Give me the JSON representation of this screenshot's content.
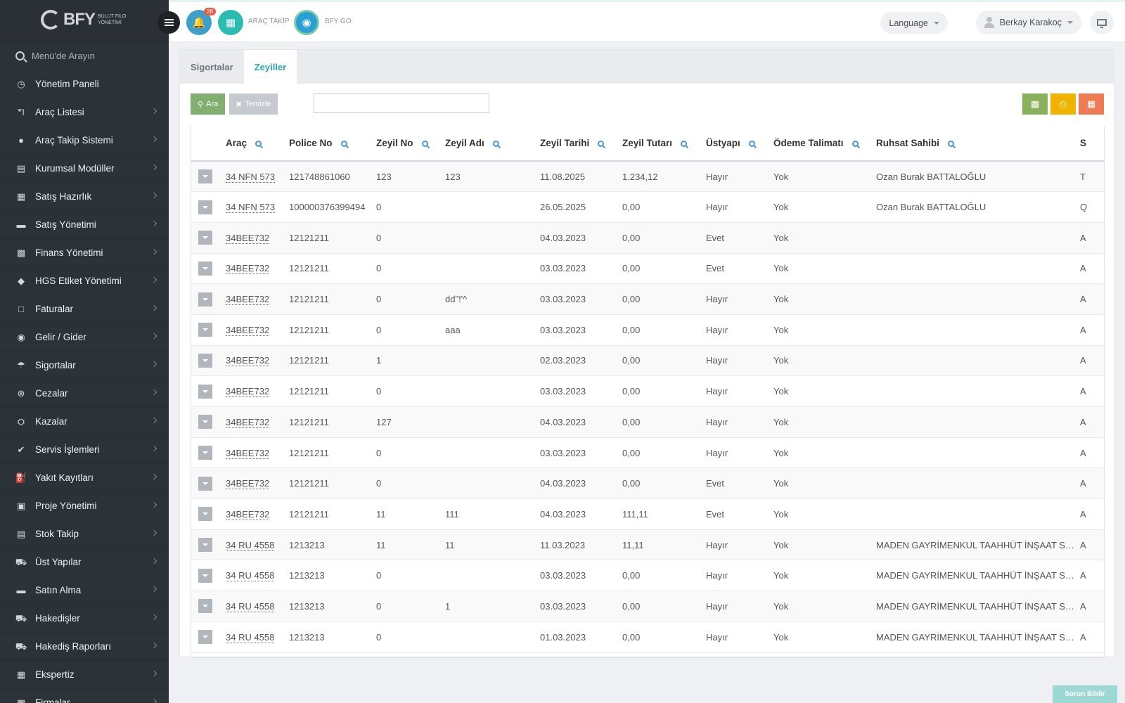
{
  "sidebar": {
    "logo": {
      "text": "BFY",
      "sub": "BULUT FİLO YÖNETİMİ"
    },
    "search_placeholder": "Menü'de Arayın",
    "items": [
      {
        "label": "Yönetim Paneli",
        "icon": "dashboard-icon",
        "chevron": false
      },
      {
        "label": "Araç Listesi",
        "icon": "car-icon",
        "chevron": true
      },
      {
        "label": "Araç Takip Sistemi",
        "icon": "map-marker-icon",
        "chevron": true
      },
      {
        "label": "Kurumsal Modüller",
        "icon": "server-icon",
        "chevron": true
      },
      {
        "label": "Satış Hazırlık",
        "icon": "book-icon",
        "chevron": true
      },
      {
        "label": "Satış Yönetimi",
        "icon": "card-icon",
        "chevron": true
      },
      {
        "label": "Finans Yönetimi",
        "icon": "money-icon",
        "chevron": true
      },
      {
        "label": "HGS Etiket Yönetimi",
        "icon": "tag-icon",
        "chevron": true
      },
      {
        "label": "Faturalar",
        "icon": "file-icon",
        "chevron": true
      },
      {
        "label": "Gelir / Gider",
        "icon": "income-icon",
        "chevron": true
      },
      {
        "label": "Sigortalar",
        "icon": "umbrella-icon",
        "chevron": true
      },
      {
        "label": "Cezalar",
        "icon": "cancel-icon",
        "chevron": true
      },
      {
        "label": "Kazalar",
        "icon": "accident-icon",
        "chevron": true
      },
      {
        "label": "Servis İşlemleri",
        "icon": "check-icon",
        "chevron": true
      },
      {
        "label": "Yakıt Kayıtları",
        "icon": "fuel-icon",
        "chevron": true
      },
      {
        "label": "Proje Yönetimi",
        "icon": "briefcase-icon",
        "chevron": true
      },
      {
        "label": "Stok Takip",
        "icon": "inbox-icon",
        "chevron": true
      },
      {
        "label": "Üst Yapılar",
        "icon": "truck-icon",
        "chevron": true
      },
      {
        "label": "Satın Alma",
        "icon": "credit-card-icon",
        "chevron": true
      },
      {
        "label": "Hakedişler",
        "icon": "truck-icon",
        "chevron": true
      },
      {
        "label": "Hakediş Raporları",
        "icon": "truck-icon",
        "chevron": true
      },
      {
        "label": "Ekspertiz",
        "icon": "building-icon",
        "chevron": true
      },
      {
        "label": "Firmalar",
        "icon": "building-icon",
        "chevron": true
      }
    ]
  },
  "topbar": {
    "notification_count": "28",
    "arac_takip": "ARAÇ TAKİP",
    "bfy_go": "BFY GO",
    "language": "Language",
    "user": "Berkay Karakoç",
    "colors": {
      "bell": "#3ea0c9",
      "map": "#2bbcb0",
      "go": "#2a9fd6"
    }
  },
  "tabs": [
    {
      "label": "Sigortalar",
      "active": false
    },
    {
      "label": "Zeyiller",
      "active": true
    }
  ],
  "toolbar": {
    "search_label": "Ara",
    "clear_label": "Temizle",
    "search_value": "",
    "export_colors": {
      "excel": "#8ab05c",
      "print": "#f0b400",
      "columns": "#ee7b54"
    }
  },
  "table": {
    "columns": [
      "Araç",
      "Police No",
      "Zeyil No",
      "Zeyil Adı",
      "Zeyil Tarihi",
      "Zeyil Tutarı",
      "Üstyapı",
      "Ödeme Talimatı",
      "Ruhsat Sahibi",
      "S"
    ],
    "rows": [
      [
        "34 NFN 573",
        "121748861060",
        "123",
        "123",
        "11.08.2025",
        "1.234,12",
        "Hayır",
        "Yok",
        "Ozan Burak BATTALOĞLU",
        "T"
      ],
      [
        "34 NFN 573",
        "100000376399494",
        "0",
        "",
        "26.05.2025",
        "0,00",
        "Hayır",
        "Yok",
        "Ozan Burak BATTALOĞLU",
        "Q"
      ],
      [
        "34BEE732",
        "12121211",
        "0",
        "",
        "04.03.2023",
        "0,00",
        "Evet",
        "Yok",
        "",
        "A"
      ],
      [
        "34BEE732",
        "12121211",
        "0",
        "",
        "03.03.2023",
        "0,00",
        "Evet",
        "Yok",
        "",
        "A"
      ],
      [
        "34BEE732",
        "12121211",
        "0",
        "dd\"!'^",
        "03.03.2023",
        "0,00",
        "Hayır",
        "Yok",
        "",
        "A"
      ],
      [
        "34BEE732",
        "12121211",
        "0",
        "aaa",
        "03.03.2023",
        "0,00",
        "Hayır",
        "Yok",
        "",
        "A"
      ],
      [
        "34BEE732",
        "12121211",
        "1",
        "",
        "02.03.2023",
        "0,00",
        "Hayır",
        "Yok",
        "",
        "A"
      ],
      [
        "34BEE732",
        "12121211",
        "0",
        "",
        "03.03.2023",
        "0,00",
        "Hayır",
        "Yok",
        "",
        "A"
      ],
      [
        "34BEE732",
        "12121211",
        "127",
        "",
        "04.03.2023",
        "0,00",
        "Hayır",
        "Yok",
        "",
        "A"
      ],
      [
        "34BEE732",
        "12121211",
        "0",
        "",
        "03.03.2023",
        "0,00",
        "Hayır",
        "Yok",
        "",
        "A"
      ],
      [
        "34BEE732",
        "12121211",
        "0",
        "",
        "04.03.2023",
        "0,00",
        "Evet",
        "Yok",
        "",
        "A"
      ],
      [
        "34BEE732",
        "12121211",
        "11",
        "111",
        "04.03.2023",
        "111,11",
        "Evet",
        "Yok",
        "",
        "A"
      ],
      [
        "34 RU 4558",
        "1213213",
        "11",
        "11",
        "11.03.2023",
        "11,11",
        "Hayır",
        "Yok",
        "MADEN GAYRİMENKUL TAAHHÜT İNŞAAT SANAYİ",
        "A"
      ],
      [
        "34 RU 4558",
        "1213213",
        "0",
        "",
        "03.03.2023",
        "0,00",
        "Hayır",
        "Yok",
        "MADEN GAYRİMENKUL TAAHHÜT İNŞAAT SANAYİ",
        "A"
      ],
      [
        "34 RU 4558",
        "1213213",
        "0",
        "1",
        "03.03.2023",
        "0,00",
        "Hayır",
        "Yok",
        "MADEN GAYRİMENKUL TAAHHÜT İNŞAAT SANAYİ",
        "A"
      ],
      [
        "34 RU 4558",
        "1213213",
        "0",
        "",
        "01.03.2023",
        "0,00",
        "Hayır",
        "Yok",
        "MADEN GAYRİMENKUL TAAHHÜT İNŞAAT SANAYİ",
        "A"
      ]
    ]
  },
  "report_button": "Sorun Bildir"
}
